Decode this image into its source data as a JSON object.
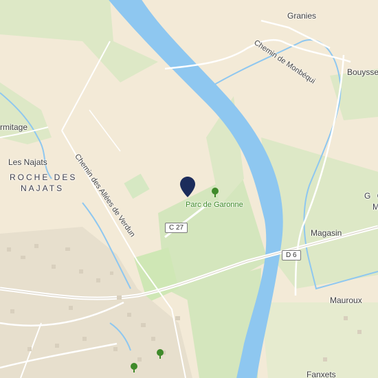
{
  "map": {
    "places": {
      "granies": "Granies",
      "bouyssel": "Bouysse",
      "ermitage": "rmitage",
      "les_najats": "Les Najats",
      "roche_line1": "ROCHE DES",
      "roche_line2": "NAJATS",
      "go_line1": "G O",
      "go_line2": "M",
      "magasin": "Magasin",
      "mauroux": "Mauroux",
      "fanxets": "Fanxets"
    },
    "roads": {
      "monbequi": "Chemin de Monbéqui",
      "allees": "Chemin des Allées de Verdun"
    },
    "shields": {
      "c27": "C 27",
      "d6": "D 6"
    },
    "poi": {
      "park": "Parc de Garonne"
    },
    "colors": {
      "land": "#f3ead7",
      "water": "#8ec7f0",
      "park": "#d6e8c3",
      "urban": "#e4dccb",
      "pin": "#1c2c5b"
    }
  }
}
